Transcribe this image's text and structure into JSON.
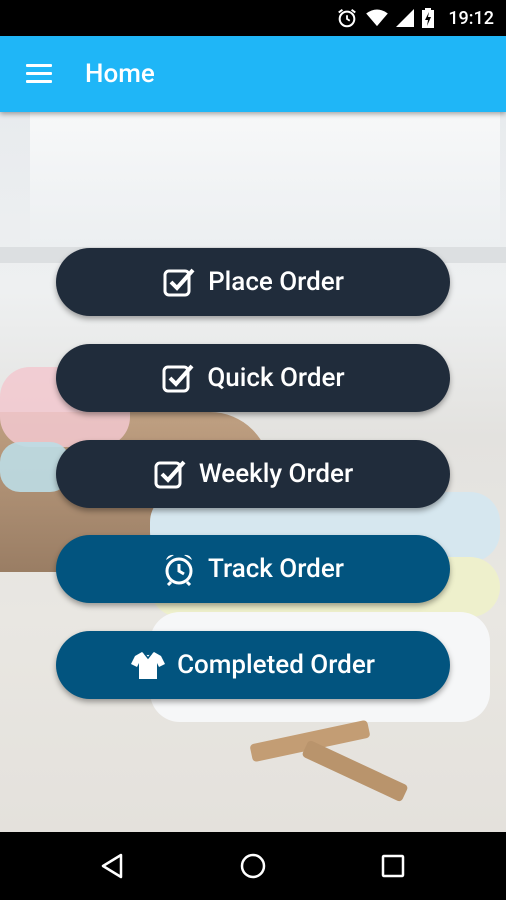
{
  "status_bar": {
    "time": "19:12"
  },
  "app_bar": {
    "title": "Home"
  },
  "buttons": [
    {
      "label": "Place Order",
      "icon": "checkbox-icon"
    },
    {
      "label": "Quick Order",
      "icon": "checkbox-icon"
    },
    {
      "label": "Weekly Order",
      "icon": "checkbox-icon"
    },
    {
      "label": "Track Order",
      "icon": "alarm-clock-icon"
    },
    {
      "label": "Completed Order",
      "icon": "shirt-icon"
    }
  ],
  "colors": {
    "app_bar": "#1fb6f7",
    "button_dark": "#202c3b",
    "button_blue": "#02547f"
  },
  "nav_bar": {
    "icons": [
      "back-icon",
      "home-icon",
      "recents-icon"
    ]
  }
}
